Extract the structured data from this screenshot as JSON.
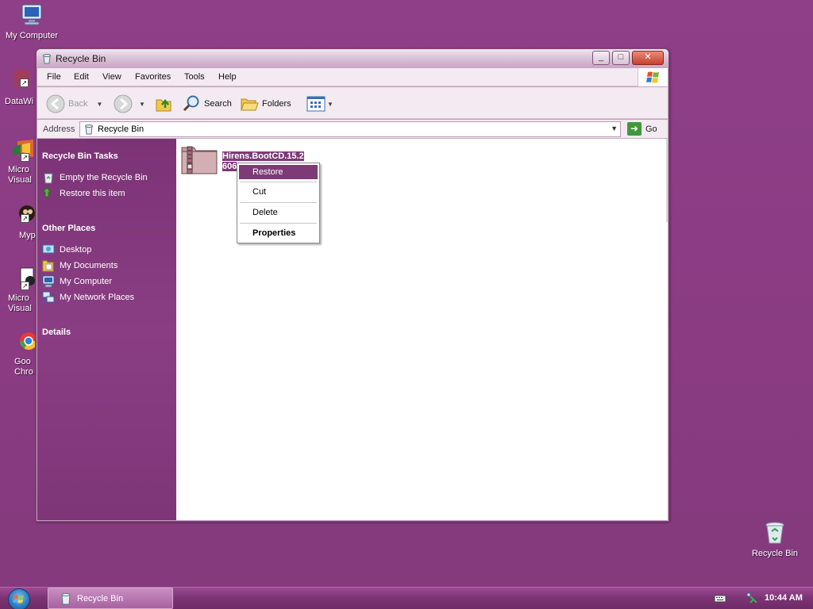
{
  "desktop": {
    "icons": [
      {
        "label": "My Computer"
      },
      {
        "label": "DataWi"
      },
      {
        "label": "Micro\nVisual"
      },
      {
        "label": "Myp"
      },
      {
        "label": "Micro\nVisual"
      },
      {
        "label": "Goo\nChro"
      },
      {
        "label": "Recycle Bin"
      }
    ]
  },
  "window": {
    "title": "Recycle Bin",
    "controls": {
      "minimize": "_",
      "maximize": "□",
      "close": "✕"
    },
    "menu": [
      "File",
      "Edit",
      "View",
      "Favorites",
      "Tools",
      "Help"
    ],
    "toolbar": {
      "back_label": "Back",
      "search_label": "Search",
      "folders_label": "Folders"
    },
    "address": {
      "label": "Address",
      "value": "Recycle Bin",
      "go_label": "Go"
    }
  },
  "taskpane": {
    "tasks_title": "Recycle Bin Tasks",
    "tasks": [
      "Empty the Recycle Bin",
      "Restore this item"
    ],
    "places_title": "Other Places",
    "places": [
      "Desktop",
      "My Documents",
      "My Computer",
      "My Network Places"
    ],
    "details_title": "Details"
  },
  "content": {
    "file": {
      "name_line1": "Hirens.BootCD.15.2",
      "name_line2": "606"
    }
  },
  "context_menu": {
    "items": [
      "Restore",
      "Cut",
      "Delete",
      "Properties"
    ],
    "active": "Restore"
  },
  "taskbar": {
    "task_label": "Recycle Bin",
    "clock": "10:44 AM"
  },
  "colors": {
    "desktop": "#8a3c83",
    "accent": "#7d3a76",
    "taskpane": "#7c3376"
  }
}
